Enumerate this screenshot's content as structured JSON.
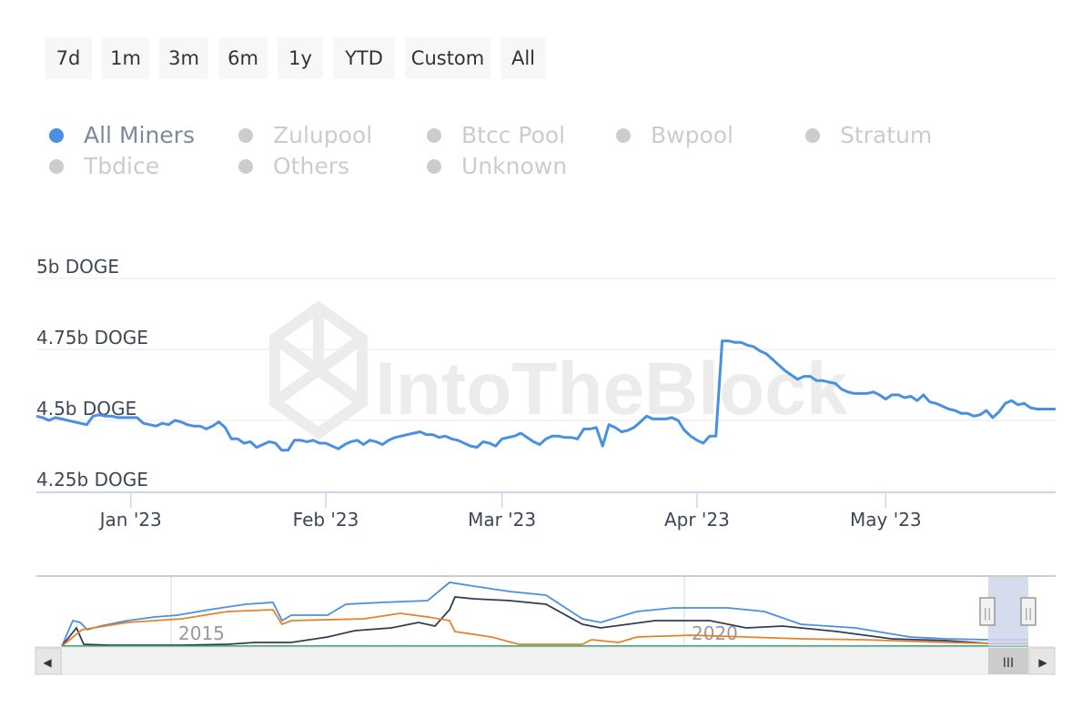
{
  "range_selector": {
    "buttons": [
      "7d",
      "1m",
      "3m",
      "6m",
      "1y",
      "YTD",
      "Custom",
      "All"
    ]
  },
  "legend": {
    "items": [
      {
        "label": "All Miners",
        "active": true
      },
      {
        "label": "Zulupool",
        "active": false
      },
      {
        "label": "Btcc Pool",
        "active": false
      },
      {
        "label": "Bwpool",
        "active": false
      },
      {
        "label": "Stratum",
        "active": false
      },
      {
        "label": "Tbdice",
        "active": false
      },
      {
        "label": "Others",
        "active": false
      },
      {
        "label": "Unknown",
        "active": false
      }
    ]
  },
  "watermark": "IntoTheBlock",
  "colors": {
    "all_miners": "#4a90e2",
    "navigator_dark": "#2f3e55",
    "navigator_orange": "#e8822a",
    "navigator_green": "#2e9e6e",
    "inactive": "#cccccc",
    "navigator_mask": "#ccd6eb"
  },
  "navigator": {
    "labels": [
      "2015",
      "2020"
    ],
    "scroll_left": "◀",
    "scroll_right": "▶",
    "scroll_grip": "III",
    "handle_grip": "||"
  },
  "chart_data": {
    "type": "line",
    "title": "",
    "xlabel": "",
    "ylabel": "",
    "unit": "b DOGE",
    "x_start": "2022-12-17",
    "x_step": "1 day",
    "x_ticks": [
      "Jan '23",
      "Feb '23",
      "Mar '23",
      "Apr '23",
      "May '23"
    ],
    "y_ticks": [
      "4.25b DOGE",
      "4.5b DOGE",
      "4.75b DOGE",
      "5b DOGE"
    ],
    "y_tick_values": [
      4.25,
      4.5,
      4.75,
      5.0
    ],
    "ylim": [
      4.25,
      5.0
    ],
    "grid": true,
    "legend_position": "top",
    "series": [
      {
        "name": "All Miners",
        "values": [
          4.515,
          4.51,
          4.5,
          4.51,
          4.505,
          4.5,
          4.495,
          4.49,
          4.485,
          4.515,
          4.52,
          4.515,
          4.515,
          4.51,
          4.51,
          4.51,
          4.51,
          4.49,
          4.485,
          4.48,
          4.49,
          4.485,
          4.5,
          4.495,
          4.485,
          4.48,
          4.48,
          4.47,
          4.48,
          4.495,
          4.475,
          4.435,
          4.435,
          4.42,
          4.425,
          4.405,
          4.415,
          4.425,
          4.42,
          4.395,
          4.395,
          4.43,
          4.43,
          4.425,
          4.43,
          4.42,
          4.42,
          4.41,
          4.4,
          4.415,
          4.425,
          4.43,
          4.415,
          4.43,
          4.425,
          4.415,
          4.43,
          4.44,
          4.445,
          4.45,
          4.455,
          4.46,
          4.45,
          4.45,
          4.44,
          4.445,
          4.435,
          4.43,
          4.42,
          4.41,
          4.405,
          4.425,
          4.42,
          4.41,
          4.435,
          4.44,
          4.445,
          4.455,
          4.44,
          4.425,
          4.415,
          4.435,
          4.445,
          4.445,
          4.44,
          4.44,
          4.435,
          4.47,
          4.47,
          4.475,
          4.41,
          4.485,
          4.475,
          4.46,
          4.465,
          4.475,
          4.495,
          4.515,
          4.505,
          4.505,
          4.505,
          4.51,
          4.5,
          4.465,
          4.445,
          4.43,
          4.42,
          4.445,
          4.445,
          4.78,
          4.78,
          4.775,
          4.775,
          4.765,
          4.76,
          4.745,
          4.735,
          4.715,
          4.695,
          4.675,
          4.66,
          4.645,
          4.655,
          4.655,
          4.64,
          4.64,
          4.635,
          4.63,
          4.61,
          4.6,
          4.595,
          4.595,
          4.595,
          4.6,
          4.59,
          4.575,
          4.59,
          4.59,
          4.58,
          4.585,
          4.57,
          4.59,
          4.565,
          4.56,
          4.55,
          4.54,
          4.535,
          4.525,
          4.525,
          4.515,
          4.52,
          4.535,
          4.51,
          4.53,
          4.56,
          4.57,
          4.555,
          4.56,
          4.545,
          4.54,
          4.54,
          4.54,
          4.54
        ]
      }
    ]
  }
}
